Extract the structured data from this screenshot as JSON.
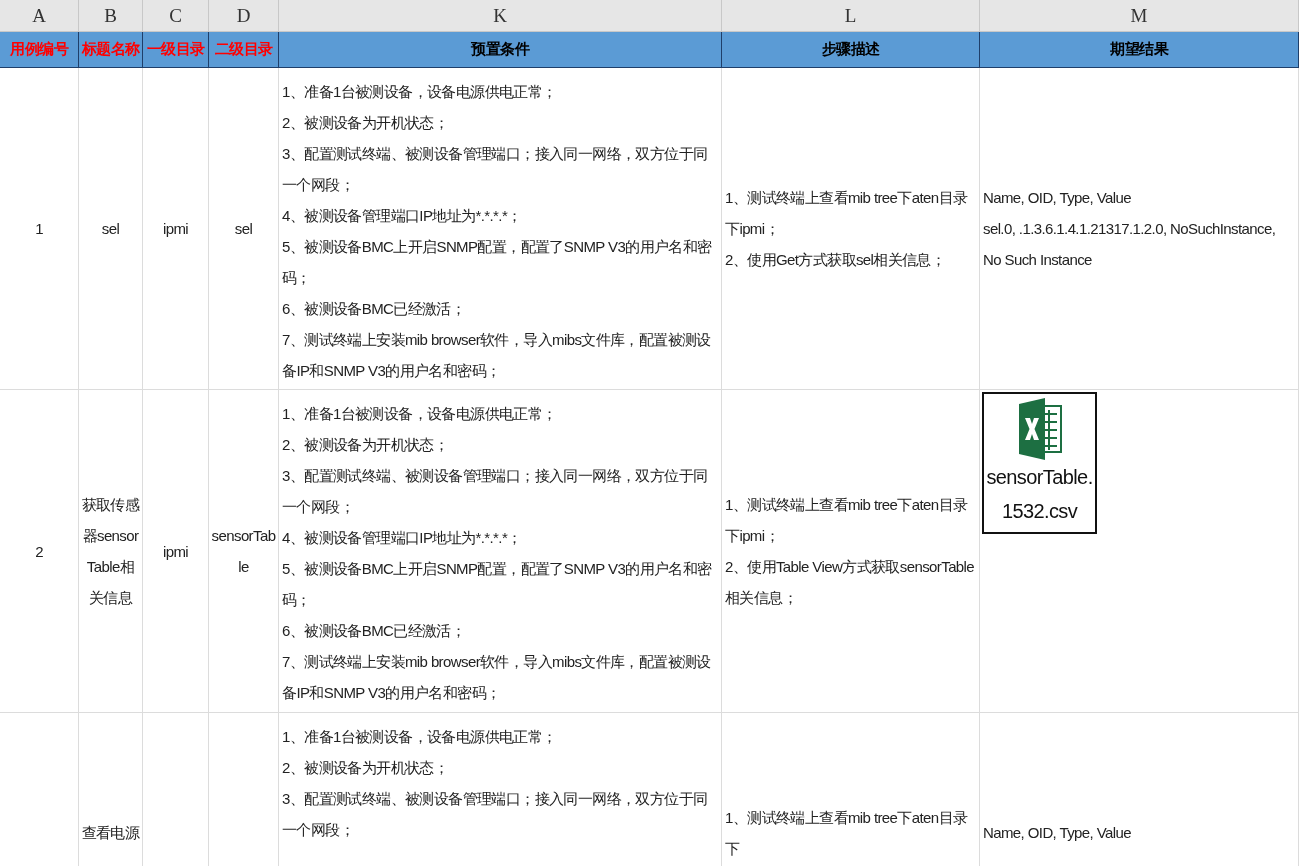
{
  "column_letters": [
    "A",
    "B",
    "C",
    "D",
    "K",
    "L",
    "M"
  ],
  "headers": [
    {
      "text": "用例编号",
      "color": "#ff0000"
    },
    {
      "text": "标题名称",
      "color": "#ff0000"
    },
    {
      "text": "一级目录",
      "color": "#ff0000"
    },
    {
      "text": "二级目录",
      "color": "#ff0000"
    },
    {
      "text": "预置条件",
      "color": "#000000"
    },
    {
      "text": "步骤描述",
      "color": "#000000"
    },
    {
      "text": "期望结果",
      "color": "#000000"
    }
  ],
  "rows": [
    {
      "case_no": "1",
      "title": "sel",
      "level1": "ipmi",
      "level2": "sel",
      "preconditions": [
        "1、准备1台被测设备，设备电源供电正常；",
        "2、被测设备为开机状态；",
        "3、配置测试终端、被测设备管理端口；接入同一网络，双方位于同一个网段；",
        "4、被测设备管理端口IP地址为*.*.*.*；",
        "5、被测设备BMC上开启SNMP配置，配置了SNMP V3的用户名和密码；",
        "6、被测设备BMC已经激活；",
        "7、测试终端上安装mib browser软件，导入mibs文件库，配置被测设备IP和SNMP V3的用户名和密码；"
      ],
      "steps": [
        "1、测试终端上查看mib tree下aten目录下ipmi；",
        "2、使用Get方式获取sel相关信息；"
      ],
      "expected": {
        "kind": "text",
        "lines": [
          "Name, OID, Type, Value",
          "sel.0, .1.3.6.1.4.1.21317.1.2.0, NoSuchInstance, No Such Instance"
        ]
      }
    },
    {
      "case_no": "2",
      "title": "获取传感器sensorTable相关信息",
      "level1": "ipmi",
      "level2": "sensorTable",
      "preconditions": [
        "1、准备1台被测设备，设备电源供电正常；",
        "2、被测设备为开机状态；",
        "3、配置测试终端、被测设备管理端口；接入同一网络，双方位于同一个网段；",
        "4、被测设备管理端口IP地址为*.*.*.*；",
        "5、被测设备BMC上开启SNMP配置，配置了SNMP V3的用户名和密码；",
        "6、被测设备BMC已经激活；",
        "7、测试终端上安装mib browser软件，导入mibs文件库，配置被测设备IP和SNMP V3的用户名和密码；"
      ],
      "steps": [
        "1、测试终端上查看mib tree下aten目录下ipmi；",
        "2、使用Table View方式获取sensorTable相关信息；"
      ],
      "expected": {
        "kind": "file",
        "label": "sensorTable.1532.csv"
      }
    },
    {
      "title": "查看电源",
      "preconditions": [
        "1、准备1台被测设备，设备电源供电正常；",
        "2、被测设备为开机状态；",
        "3、配置测试终端、被测设备管理端口；接入同一网络，双方位于同一个网段；"
      ],
      "steps": [
        "1、测试终端上查看mib tree下aten目录下"
      ],
      "expected": {
        "kind": "text",
        "lines": [
          "Name, OID, Type, Value"
        ]
      }
    }
  ]
}
